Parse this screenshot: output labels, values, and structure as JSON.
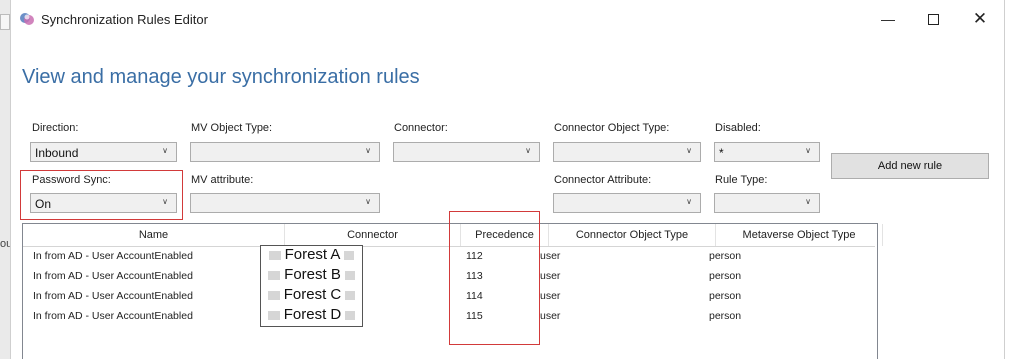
{
  "window": {
    "title": "Synchronization Rules Editor",
    "minimize_icon": "minimize-icon",
    "maximize_icon": "maximize-icon",
    "close_icon": "close-icon"
  },
  "page": {
    "title": "View and manage your synchronization rules"
  },
  "filters": {
    "direction": {
      "label": "Direction:",
      "value": "Inbound"
    },
    "mv_object_type": {
      "label": "MV Object Type:",
      "value": ""
    },
    "connector": {
      "label": "Connector:",
      "value": ""
    },
    "connector_object_type": {
      "label": "Connector Object Type:",
      "value": ""
    },
    "disabled": {
      "label": "Disabled:",
      "value": "*"
    },
    "password_sync": {
      "label": "Password Sync:",
      "value": "On"
    },
    "mv_attribute": {
      "label": "MV attribute:",
      "value": ""
    },
    "connector_attribute": {
      "label": "Connector Attribute:",
      "value": ""
    },
    "rule_type": {
      "label": "Rule Type:",
      "value": ""
    }
  },
  "add_button": {
    "label": "Add new rule"
  },
  "table": {
    "columns": [
      "Name",
      "Connector",
      "Precedence",
      "Connector Object Type",
      "Metaverse Object Type"
    ],
    "rows": [
      {
        "name": "In from AD - User AccountEnabled",
        "connector": "Forest A",
        "precedence": "112",
        "connector_object_type": "user",
        "metaverse_object_type": "person"
      },
      {
        "name": "In from AD - User AccountEnabled",
        "connector": "Forest B",
        "precedence": "113",
        "connector_object_type": "user",
        "metaverse_object_type": "person"
      },
      {
        "name": "In from AD - User AccountEnabled",
        "connector": "Forest C",
        "precedence": "114",
        "connector_object_type": "user",
        "metaverse_object_type": "person"
      },
      {
        "name": "In from AD - User AccountEnabled",
        "connector": "Forest D",
        "precedence": "115",
        "connector_object_type": "user",
        "metaverse_object_type": "person"
      }
    ]
  },
  "background": {
    "partial_text": "ou"
  },
  "colors": {
    "title_blue": "#3a6ea5",
    "highlight_red": "#d23a3a"
  }
}
